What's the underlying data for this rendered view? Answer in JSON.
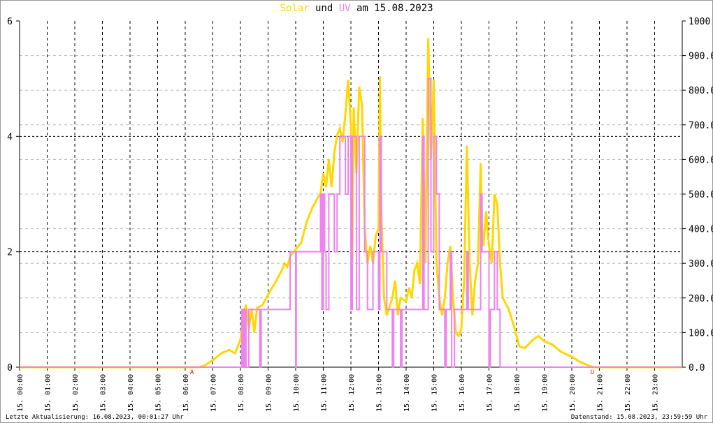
{
  "chart_data": {
    "type": "line",
    "title": {
      "part1": "Solar",
      "part2": " und ",
      "part3": "UV",
      "part4": " am 15.08.2023"
    },
    "colors": {
      "solar": "#FFD700",
      "uv": "#EE82EE",
      "annot": "#FF0000"
    },
    "x_range_hours": [
      0,
      24
    ],
    "x_tick_labels": [
      "15. 00:00",
      "15. 01:00",
      "15. 02:00",
      "15. 03:00",
      "15. 04:00",
      "15. 05:00",
      "15. 06:00",
      "15. 07:00",
      "15. 08:00",
      "15. 09:00",
      "15. 10:00",
      "15. 11:00",
      "15. 12:00",
      "15. 13:00",
      "15. 14:00",
      "15. 15:00",
      "15. 16:00",
      "15. 17:00",
      "15. 18:00",
      "15. 19:00",
      "15. 20:00",
      "15. 21:00",
      "15. 22:00",
      "15. 23:00"
    ],
    "y_left": {
      "range": [
        0,
        6
      ],
      "ticks": [
        "0",
        "2",
        "4",
        "6"
      ]
    },
    "y_right": {
      "range": [
        0,
        1000
      ],
      "ticks": [
        "0.0",
        "100.0",
        "200.0",
        "300.0",
        "400.0",
        "500.0",
        "600.0",
        "700.0",
        "800.0",
        "900.0",
        "1000"
      ]
    },
    "annotations": [
      {
        "label": "A",
        "hour": 6.25
      },
      {
        "label": "U",
        "hour": 20.75
      }
    ],
    "series": [
      {
        "name": "Solar",
        "axis": "right",
        "points": [
          [
            0,
            0
          ],
          [
            6.5,
            0
          ],
          [
            6.7,
            5
          ],
          [
            7.0,
            20
          ],
          [
            7.3,
            40
          ],
          [
            7.6,
            50
          ],
          [
            7.8,
            40
          ],
          [
            8.0,
            80
          ],
          [
            8.1,
            150
          ],
          [
            8.2,
            180
          ],
          [
            8.3,
            110
          ],
          [
            8.4,
            170
          ],
          [
            8.5,
            100
          ],
          [
            8.6,
            170
          ],
          [
            8.7,
            175
          ],
          [
            8.8,
            180
          ],
          [
            9.0,
            210
          ],
          [
            9.3,
            250
          ],
          [
            9.5,
            280
          ],
          [
            9.6,
            300
          ],
          [
            9.7,
            290
          ],
          [
            9.8,
            320
          ],
          [
            10.0,
            340
          ],
          [
            10.2,
            360
          ],
          [
            10.4,
            420
          ],
          [
            10.6,
            460
          ],
          [
            10.8,
            490
          ],
          [
            10.9,
            500
          ],
          [
            11.0,
            560
          ],
          [
            11.1,
            520
          ],
          [
            11.2,
            600
          ],
          [
            11.3,
            520
          ],
          [
            11.4,
            620
          ],
          [
            11.5,
            670
          ],
          [
            11.6,
            690
          ],
          [
            11.7,
            650
          ],
          [
            11.8,
            730
          ],
          [
            11.9,
            830
          ],
          [
            12.0,
            700
          ],
          [
            12.05,
            300
          ],
          [
            12.1,
            750
          ],
          [
            12.2,
            560
          ],
          [
            12.3,
            810
          ],
          [
            12.4,
            760
          ],
          [
            12.5,
            400
          ],
          [
            12.6,
            300
          ],
          [
            12.7,
            350
          ],
          [
            12.8,
            300
          ],
          [
            12.9,
            380
          ],
          [
            13.0,
            400
          ],
          [
            13.05,
            840
          ],
          [
            13.1,
            450
          ],
          [
            13.2,
            200
          ],
          [
            13.3,
            150
          ],
          [
            13.5,
            200
          ],
          [
            13.6,
            250
          ],
          [
            13.7,
            150
          ],
          [
            13.8,
            200
          ],
          [
            14.0,
            190
          ],
          [
            14.1,
            230
          ],
          [
            14.2,
            200
          ],
          [
            14.3,
            280
          ],
          [
            14.4,
            300
          ],
          [
            14.5,
            240
          ],
          [
            14.6,
            720
          ],
          [
            14.7,
            300
          ],
          [
            14.8,
            950
          ],
          [
            14.9,
            600
          ],
          [
            15.0,
            830
          ],
          [
            15.1,
            300
          ],
          [
            15.2,
            200
          ],
          [
            15.3,
            150
          ],
          [
            15.4,
            200
          ],
          [
            15.5,
            300
          ],
          [
            15.6,
            350
          ],
          [
            15.7,
            200
          ],
          [
            15.8,
            100
          ],
          [
            15.9,
            90
          ],
          [
            16.0,
            110
          ],
          [
            16.1,
            250
          ],
          [
            16.2,
            640
          ],
          [
            16.3,
            300
          ],
          [
            16.4,
            150
          ],
          [
            16.5,
            250
          ],
          [
            16.6,
            300
          ],
          [
            16.7,
            590
          ],
          [
            16.75,
            400
          ],
          [
            16.8,
            350
          ],
          [
            16.9,
            450
          ],
          [
            17.0,
            350
          ],
          [
            17.1,
            300
          ],
          [
            17.2,
            500
          ],
          [
            17.3,
            470
          ],
          [
            17.4,
            300
          ],
          [
            17.5,
            200
          ],
          [
            17.7,
            170
          ],
          [
            17.9,
            120
          ],
          [
            18.0,
            90
          ],
          [
            18.1,
            60
          ],
          [
            18.3,
            55
          ],
          [
            18.6,
            80
          ],
          [
            18.8,
            90
          ],
          [
            19.0,
            75
          ],
          [
            19.3,
            65
          ],
          [
            19.6,
            45
          ],
          [
            20.0,
            30
          ],
          [
            20.3,
            15
          ],
          [
            20.6,
            5
          ],
          [
            20.8,
            0
          ],
          [
            24,
            0
          ]
        ]
      },
      {
        "name": "UV",
        "axis": "left",
        "step": true,
        "points": [
          [
            0,
            0
          ],
          [
            8.05,
            1
          ],
          [
            8.1,
            0
          ],
          [
            8.15,
            1
          ],
          [
            8.2,
            0
          ],
          [
            8.3,
            1
          ],
          [
            8.7,
            0
          ],
          [
            8.75,
            1
          ],
          [
            9.8,
            2
          ],
          [
            10.0,
            0
          ],
          [
            10.02,
            2
          ],
          [
            10.9,
            3
          ],
          [
            10.95,
            1
          ],
          [
            11.0,
            3
          ],
          [
            11.05,
            2
          ],
          [
            11.1,
            1
          ],
          [
            11.2,
            3
          ],
          [
            11.4,
            2
          ],
          [
            11.5,
            3
          ],
          [
            11.6,
            4
          ],
          [
            11.8,
            3
          ],
          [
            11.9,
            4
          ],
          [
            12.0,
            1
          ],
          [
            12.05,
            4
          ],
          [
            12.2,
            1
          ],
          [
            12.3,
            4
          ],
          [
            12.5,
            2
          ],
          [
            12.6,
            1
          ],
          [
            12.8,
            2
          ],
          [
            13.0,
            1
          ],
          [
            13.05,
            4
          ],
          [
            13.1,
            2
          ],
          [
            13.3,
            1
          ],
          [
            13.5,
            0
          ],
          [
            13.55,
            1
          ],
          [
            13.8,
            0
          ],
          [
            13.85,
            1
          ],
          [
            14.6,
            4
          ],
          [
            14.65,
            1
          ],
          [
            14.8,
            5
          ],
          [
            14.9,
            2
          ],
          [
            15.0,
            4
          ],
          [
            15.1,
            3
          ],
          [
            15.2,
            1
          ],
          [
            15.4,
            0
          ],
          [
            15.45,
            1
          ],
          [
            15.6,
            2
          ],
          [
            15.65,
            0
          ],
          [
            15.75,
            1
          ],
          [
            16.2,
            2
          ],
          [
            16.25,
            1
          ],
          [
            16.7,
            3
          ],
          [
            16.75,
            2
          ],
          [
            17.0,
            0
          ],
          [
            17.05,
            1
          ],
          [
            17.2,
            2
          ],
          [
            17.3,
            1
          ],
          [
            17.4,
            0
          ],
          [
            24,
            0
          ]
        ]
      }
    ]
  },
  "footer": {
    "left": "Letzte Aktualisierung: 16.08.2023, 00:01:27 Uhr",
    "right": "Datenstand: 15.08.2023, 23:59:59 Uhr"
  }
}
